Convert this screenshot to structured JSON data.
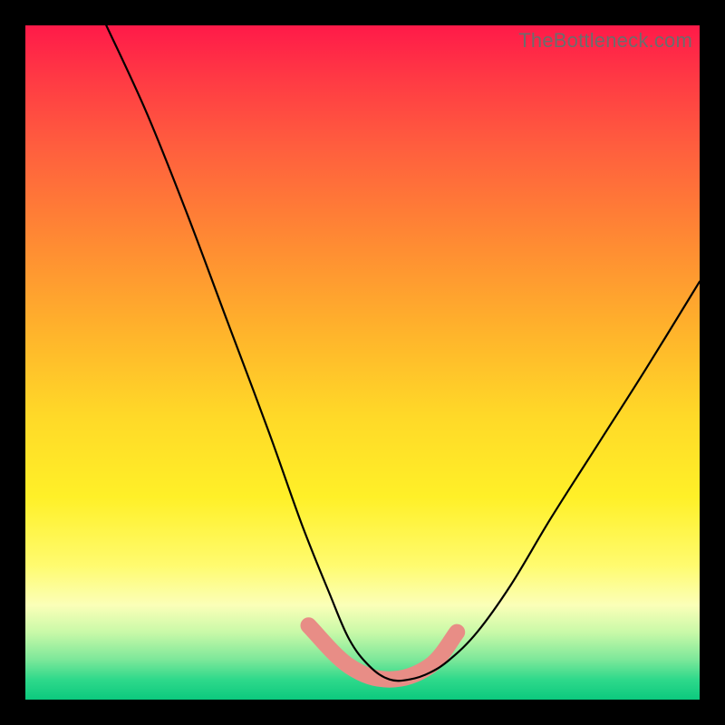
{
  "watermark": "TheBottleneck.com",
  "chart_data": {
    "type": "line",
    "title": "",
    "xlabel": "",
    "ylabel": "",
    "xlim": [
      0,
      100
    ],
    "ylim": [
      0,
      100
    ],
    "background": "rainbow-vertical-gradient",
    "series": [
      {
        "name": "bottleneck-curve",
        "color": "#000000",
        "x": [
          12,
          18,
          24,
          30,
          36,
          41,
          45,
          48,
          51,
          54,
          57,
          60,
          63,
          67,
          72,
          78,
          85,
          92,
          100
        ],
        "y": [
          100,
          87,
          72,
          56,
          40,
          26,
          16,
          9,
          5,
          3,
          3,
          4,
          6,
          10,
          17,
          27,
          38,
          49,
          62
        ]
      },
      {
        "name": "highlight-band",
        "color": "#e88d86",
        "x": [
          42,
          48,
          54,
          60,
          64
        ],
        "y": [
          11,
          5,
          3,
          5,
          10
        ]
      }
    ],
    "grid": false,
    "legend": false
  }
}
